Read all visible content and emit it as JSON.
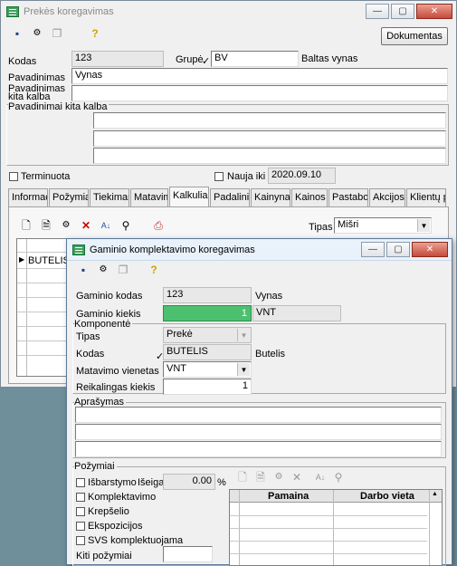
{
  "main_window": {
    "title": "Prekės koregavimas",
    "documents_button": "Dokumentas",
    "kodas_label": "Kodas",
    "kodas_value": "123",
    "grupe_label": "Grupė",
    "grupe_value": "BV",
    "grupe_name": "Baltas vynas",
    "pavadinimas_label": "Pavadinimas",
    "pavadinimas_value": "Vynas",
    "pavadinimas_kita_label_1": "Pavadinimas",
    "pavadinimas_kita_label_2": "kita kalba",
    "pavadinimai_kita_label": "Pavadinimai kita kalba",
    "terminuota_label": "Terminuota",
    "nauja_iki_label": "Nauja iki",
    "nauja_iki_value": "2020.09.10",
    "tabs": [
      "Informac",
      "Požymiai",
      "Tiekimas",
      "Matavima",
      "Kalkuliac",
      "Padalinia",
      "Kainynas",
      "Kainos",
      "Pastabos",
      "Akcijos",
      "Klientų pr"
    ],
    "tipas_label": "Tipas",
    "tipas_value": "Mišri",
    "grid_row_1": "BUTELIS"
  },
  "dialog": {
    "title": "Gaminio komplektavimo koregavimas",
    "gaminio_kodas_label": "Gaminio kodas",
    "gaminio_kodas_value": "123",
    "gaminio_kodas_name": "Vynas",
    "gaminio_kiekis_label": "Gaminio kiekis",
    "gaminio_kiekis_value": "1",
    "gaminio_kiekis_unit": "VNT",
    "komponente_label": "Komponentė",
    "tipas_label": "Tipas",
    "tipas_value": "Prekė",
    "kodas_label": "Kodas",
    "kodas_value": "BUTELIS",
    "kodas_name": "Butelis",
    "matavimo_label": "Matavimo vienetas",
    "matavimo_value": "VNT",
    "reikalingas_label": "Reikalingas kiekis",
    "reikalingas_value": "1",
    "aprasymas_label": "Aprašymas",
    "pozymiai_label": "Požymiai",
    "isbarstymo_label": "Išbarstymo",
    "iseiga_label": "Išeiga",
    "iseiga_value": "0.00",
    "iseiga_unit": "%",
    "komplektavimo_label": "Komplektavimo",
    "krepselio_label": "Krepšelio",
    "ekspozicijos_label": "Ekspozicijos",
    "svs_label": "SVS komplektuojama",
    "kiti_pozymiai_label": "Kiti požymiai",
    "grid_col_pamaina": "Pamaina",
    "grid_col_darbo_vieta": "Darbo vieta"
  }
}
